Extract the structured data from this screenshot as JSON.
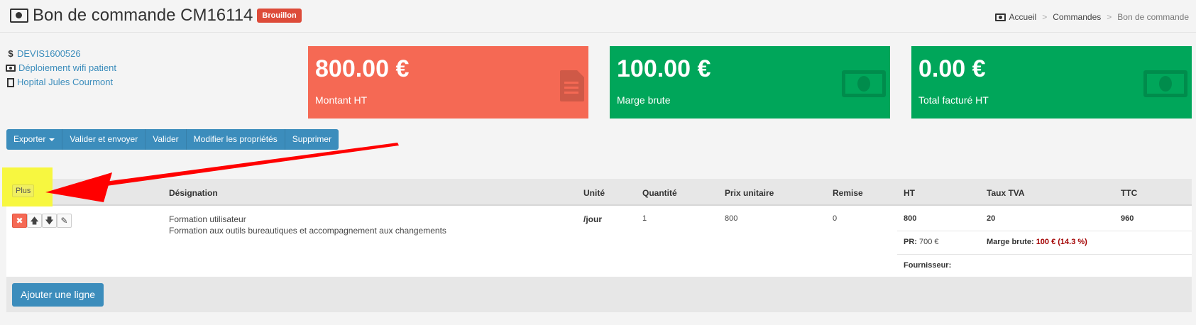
{
  "header": {
    "title": "Bon de commande CM16114",
    "badge": "Brouillon",
    "breadcrumb": [
      "Accueil",
      "Commandes",
      "Bon de commande"
    ]
  },
  "info": {
    "devis": "DEVIS1600526",
    "project": "Déploiement wifi patient",
    "client": "Hopital Jules Courmont"
  },
  "stats": [
    {
      "value": "800.00 €",
      "label": "Montant HT",
      "color": "#f56954",
      "icon": "document-icon"
    },
    {
      "value": "100.00 €",
      "label": "Marge brute",
      "color": "#00a65a",
      "icon": "money-icon"
    },
    {
      "value": "0.00 €",
      "label": "Total facturé HT",
      "color": "#00a65a",
      "icon": "money-icon"
    }
  ],
  "toolbar": [
    "Exporter",
    "Valider et envoyer",
    "Valider",
    "Modifier les propriétés",
    "Supprimer"
  ],
  "table": {
    "more_label": "Plus",
    "headers": [
      "Désignation",
      "Unité",
      "Quantité",
      "Prix unitaire",
      "Remise",
      "HT",
      "Taux TVA",
      "TTC"
    ],
    "row": {
      "designation": "Formation utilisateur",
      "description": "Formation aux outils bureautiques et accompagnement aux changements",
      "unit": "/jour",
      "quantity": "1",
      "unit_price": "800",
      "discount": "0",
      "ht": "800",
      "tva": "20",
      "ttc": "960",
      "pr_label": "PR:",
      "pr_value": "700 €",
      "marge_label": "Marge brute:",
      "marge_value": "100 € (14.3 %)",
      "fournisseur_label": "Fournisseur:"
    },
    "add_line": "Ajouter une ligne"
  },
  "annotation": {
    "highlight_color": "#f7f740",
    "arrow_color": "#ff0000"
  }
}
